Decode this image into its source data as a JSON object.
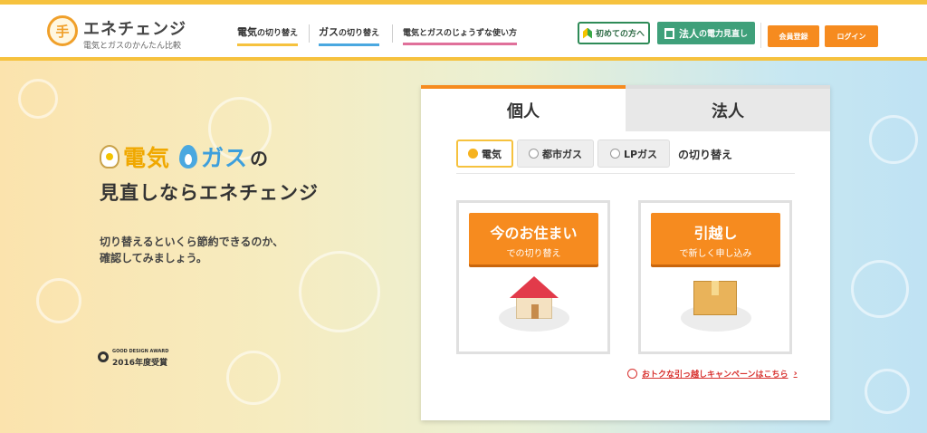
{
  "header": {
    "logo_glyph": "手",
    "logo_title": "エネチェンジ",
    "logo_subtitle": "電気とガスのかんたん比較",
    "nav": [
      {
        "main": "電気",
        "sub": "の切り替え"
      },
      {
        "main": "ガス",
        "sub": "の切り替え"
      },
      {
        "main": "電気とガスのじょうずな使い方",
        "sub": ""
      }
    ],
    "btn_beginner": "初めての方へ",
    "btn_corp_main": "法人",
    "btn_corp_sub": "の電力見直し",
    "btn_member": "会員登録",
    "btn_login": "ログイン"
  },
  "hero": {
    "headline_elec": "電気",
    "headline_gas": "ガス",
    "headline_no": "の",
    "headline2": "見直しならエネチェンジ",
    "lead_line1": "切り替えるといくら節約できるのか、",
    "lead_line2": "確認してみましょう。",
    "award_line1": "GOOD DESIGN AWARD",
    "award_line2": "2016年度受賞"
  },
  "panel": {
    "tab_personal": "個人",
    "tab_corp": "法人",
    "options": [
      "電気",
      "都市ガス",
      "LPガス"
    ],
    "switch_label": "の切り替え",
    "card_home_main": "今のお住まい",
    "card_home_sub": "での切り替え",
    "card_move_main": "引越し",
    "card_move_sub": "で新しく申し込み",
    "campaign_link": "おトクな引っ越しキャンペーンはこちら",
    "campaign_chevron": "›"
  },
  "colors": {
    "accent_orange": "#f68b1f",
    "accent_yellow": "#f6c23e",
    "gas_blue": "#3d9fdc",
    "corp_green": "#3fa07a"
  }
}
